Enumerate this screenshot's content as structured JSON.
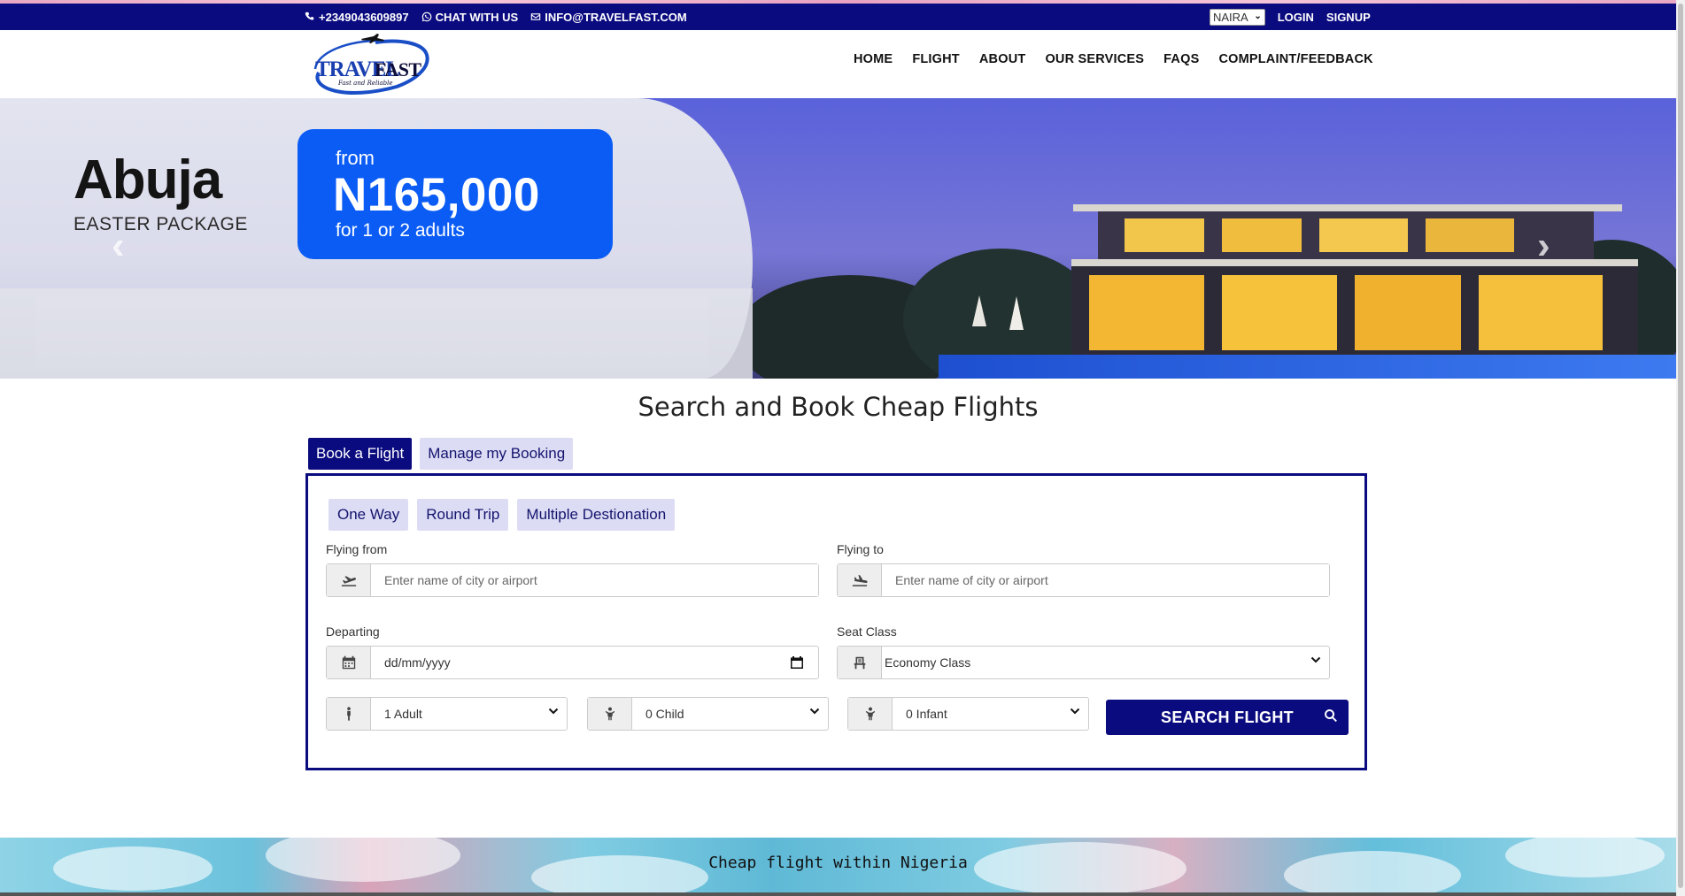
{
  "topbar": {
    "phone": "+2349043609897",
    "chat": "CHAT WITH US",
    "email": "INFO@TRAVELFAST.COM",
    "currency": "NAIRA",
    "login": "LOGIN",
    "signup": "SIGNUP"
  },
  "logo": {
    "text_main": "TRAVEL",
    "text_accent": "FAST",
    "tagline": "Fast and Reliable"
  },
  "nav": {
    "items": [
      "HOME",
      "FLIGHT",
      "ABOUT",
      "OUR SERVICES",
      "FAQS",
      "COMPLAINT/FEEDBACK"
    ]
  },
  "hero": {
    "city": "Abuja",
    "package": "EASTER PACKAGE",
    "from": "from",
    "price": "N165,000",
    "for": "for 1 or 2 adults"
  },
  "booking": {
    "title": "Search and Book Cheap Flights",
    "tabs": [
      "Book a Flight",
      "Manage my Booking"
    ],
    "trip_types": [
      "One Way",
      "Round Trip",
      "Multiple Destionation"
    ],
    "flying_from_label": "Flying from",
    "flying_from_placeholder": "Enter name of city or airport",
    "flying_to_label": "Flying to",
    "flying_to_placeholder": "Enter name of city or airport",
    "departing_label": "Departing",
    "departing_placeholder": "dd/mm/yyyy",
    "seat_class_label": "Seat Class",
    "seat_class_value": "Economy Class",
    "adults_value": "1 Adult",
    "child_value": "0 Child",
    "infant_value": "0 Infant",
    "search_button": "SEARCH FLIGHT"
  },
  "banner": {
    "text": "Cheap flight within Nigeria"
  },
  "colors": {
    "brand_navy": "#0b0b80",
    "tab_inactive": "#dcdcf5",
    "promo_blue": "#0b5cf5"
  }
}
